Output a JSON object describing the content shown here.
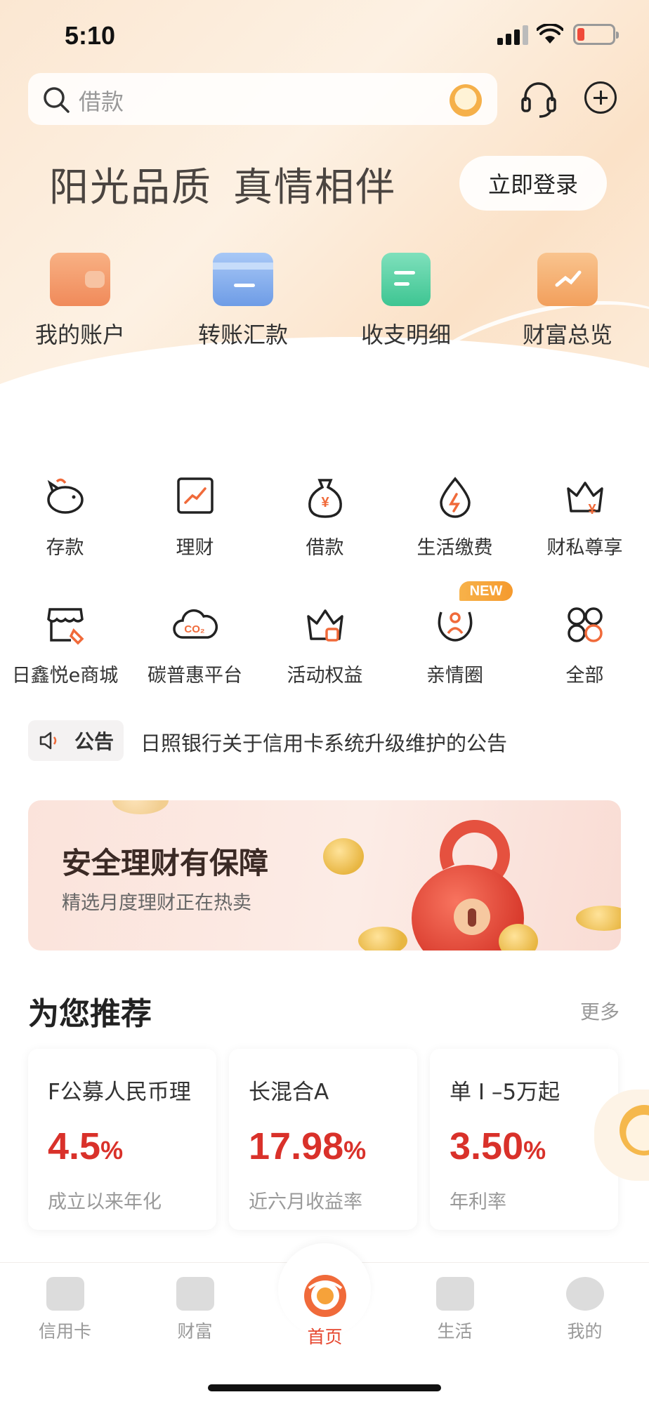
{
  "status_bar": {
    "time": "5:10"
  },
  "search": {
    "placeholder": "借款"
  },
  "hero": {
    "slogan_1": "阳光品质",
    "slogan_2": "真情相伴",
    "login_label": "立即登录"
  },
  "quick_actions": [
    {
      "label": "我的账户",
      "icon": "wallet-icon",
      "color": "#f4a070"
    },
    {
      "label": "转账汇款",
      "icon": "transfer-card-icon",
      "color": "#8fb6f2"
    },
    {
      "label": "收支明细",
      "icon": "clipboard-icon",
      "color": "#5fd0a6"
    },
    {
      "label": "财富总览",
      "icon": "trend-monitor-icon",
      "color": "#f5b47a"
    }
  ],
  "services": [
    {
      "label": "存款",
      "icon": "piggy-bank-icon"
    },
    {
      "label": "理财",
      "icon": "chart-trend-icon"
    },
    {
      "label": "借款",
      "icon": "money-bag-icon"
    },
    {
      "label": "生活缴费",
      "icon": "utility-drop-icon"
    },
    {
      "label": "财私尊享",
      "icon": "crown-yuan-icon"
    },
    {
      "label": "日鑫悦e商城",
      "icon": "shop-icon"
    },
    {
      "label": "碳普惠平台",
      "icon": "co2-cloud-icon"
    },
    {
      "label": "活动权益",
      "icon": "crown-bag-icon"
    },
    {
      "label": "亲情圈",
      "icon": "family-icon",
      "badge": "NEW"
    },
    {
      "label": "全部",
      "icon": "grid-all-icon"
    }
  ],
  "notice": {
    "tag": "公告",
    "text": "日照银行关于信用卡系统升级维护的公告"
  },
  "banner": {
    "title": "安全理财有保障",
    "subtitle": "精选月度理财正在热卖"
  },
  "recommend": {
    "title": "为您推荐",
    "more": "更多",
    "cards": [
      {
        "name": "F公募人民币理",
        "rate": "4.5",
        "unit": "%",
        "desc": "成立以来年化"
      },
      {
        "name": "长混合A",
        "rate": "17.98",
        "unit": "%",
        "desc": "近六月收益率"
      },
      {
        "name": "单 I –5万起",
        "rate": "3.50",
        "unit": "%",
        "desc": "年利率"
      }
    ]
  },
  "tabbar": [
    {
      "label": "信用卡",
      "icon": "credit-card-icon",
      "active": false
    },
    {
      "label": "财富",
      "icon": "wallet-tab-icon",
      "active": false
    },
    {
      "label": "首页",
      "icon": "home-logo-icon",
      "active": true
    },
    {
      "label": "生活",
      "icon": "shopping-bag-icon",
      "active": false
    },
    {
      "label": "我的",
      "icon": "user-icon",
      "active": false
    }
  ],
  "colors": {
    "accent": "#e6462e",
    "rate_red": "#d9312a"
  }
}
